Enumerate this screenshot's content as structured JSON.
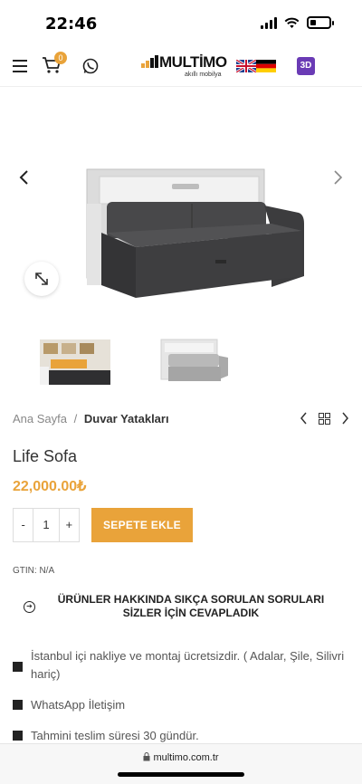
{
  "status": {
    "time": "22:46"
  },
  "header": {
    "cart_count": "0",
    "logo_name": "MULTİMO",
    "logo_sub": "akıllı mobilya",
    "btn_3d": "3D"
  },
  "breadcrumb": {
    "home": "Ana Sayfa",
    "sep": "/",
    "current": "Duvar Yatakları"
  },
  "product": {
    "title": "Life Sofa",
    "price": "22,000.00₺",
    "qty_minus": "-",
    "qty_value": "1",
    "qty_plus": "+",
    "add_to_cart": "SEPETE EKLE",
    "gtin": "GTIN: N/A"
  },
  "faq": {
    "text": "ÜRÜNLER HAKKINDA SIKÇA SORULAN SORULARI SİZLER İÇİN CEVAPLADIK"
  },
  "features": [
    "İstanbul içi nakliye ve montaj ücretsizdir. ( Adalar, Şile, Silivri hariç)",
    "WhatsApp İletişim",
    "Tahmini teslim süresi 30 gündür."
  ],
  "browser": {
    "url": "multimo.com.tr"
  },
  "colors": {
    "accent": "#e9a33a",
    "sofa": "#3a3a3c",
    "frame": "#d8d8d8"
  }
}
